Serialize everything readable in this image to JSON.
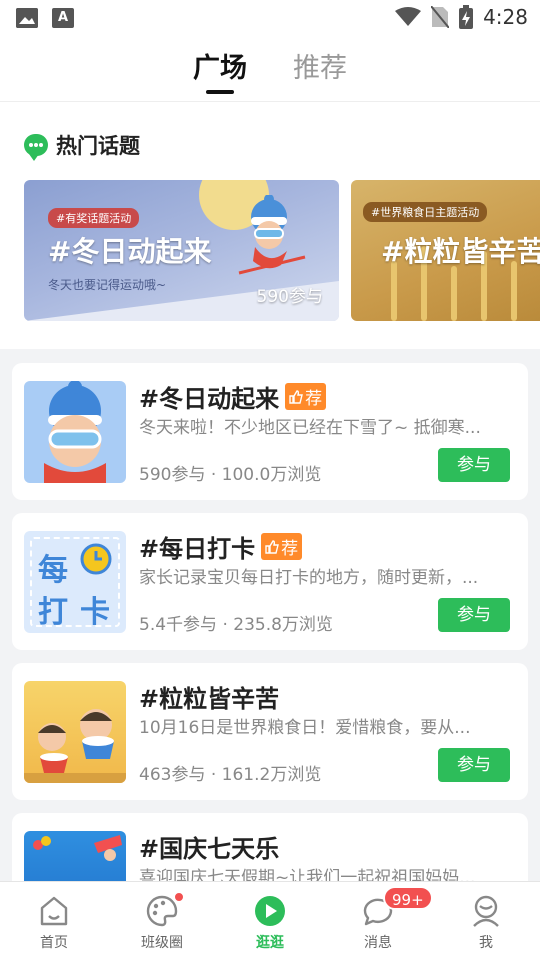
{
  "status_bar": {
    "time": "4:28"
  },
  "top_tabs": [
    {
      "label": "广场",
      "active": true
    },
    {
      "label": "推荐",
      "active": false
    }
  ],
  "hot_topics": {
    "title": "热门话题",
    "banners": [
      {
        "tag": "#有奖话题活动",
        "title": "#冬日动起来",
        "subtitle": "冬天也要记得运动哦~",
        "count": "590参与"
      },
      {
        "tag": "#世界粮食日主题活动",
        "title": "#粒粒皆辛苦"
      }
    ]
  },
  "topics": [
    {
      "title": "#冬日动起来",
      "recommended": true,
      "rec_label": "荐",
      "desc": "冬天来啦！不少地区已经在下雪了~ 抵御寒...",
      "stats": "590参与 · 100.0万浏览",
      "button": "参与"
    },
    {
      "title": "#每日打卡",
      "recommended": true,
      "rec_label": "荐",
      "desc": "家长记录宝贝每日打卡的地方，随时更新，...",
      "stats": "5.4千参与 · 235.8万浏览",
      "button": "参与",
      "image_text": [
        "每",
        "打",
        "卡"
      ]
    },
    {
      "title": "#粒粒皆辛苦",
      "recommended": false,
      "desc": "10月16日是世界粮食日！爱惜粮食，要从...",
      "stats": "463参与 · 161.2万浏览",
      "button": "参与"
    },
    {
      "title": "#国庆七天乐",
      "recommended": false,
      "desc": "喜迎国庆七天假期~让我们一起祝祖国妈妈..."
    }
  ],
  "bottom_nav": [
    {
      "label": "首页",
      "icon": "home-icon"
    },
    {
      "label": "班级圈",
      "icon": "palette-icon",
      "dot": true
    },
    {
      "label": "逛逛",
      "icon": "play-icon",
      "active": true
    },
    {
      "label": "消息",
      "icon": "message-icon",
      "badge": "99+"
    },
    {
      "label": "我",
      "icon": "profile-icon"
    }
  ],
  "colors": {
    "accent": "#2dbd5a",
    "badge_orange": "#ff8a2a",
    "badge_red": "#f25050"
  }
}
